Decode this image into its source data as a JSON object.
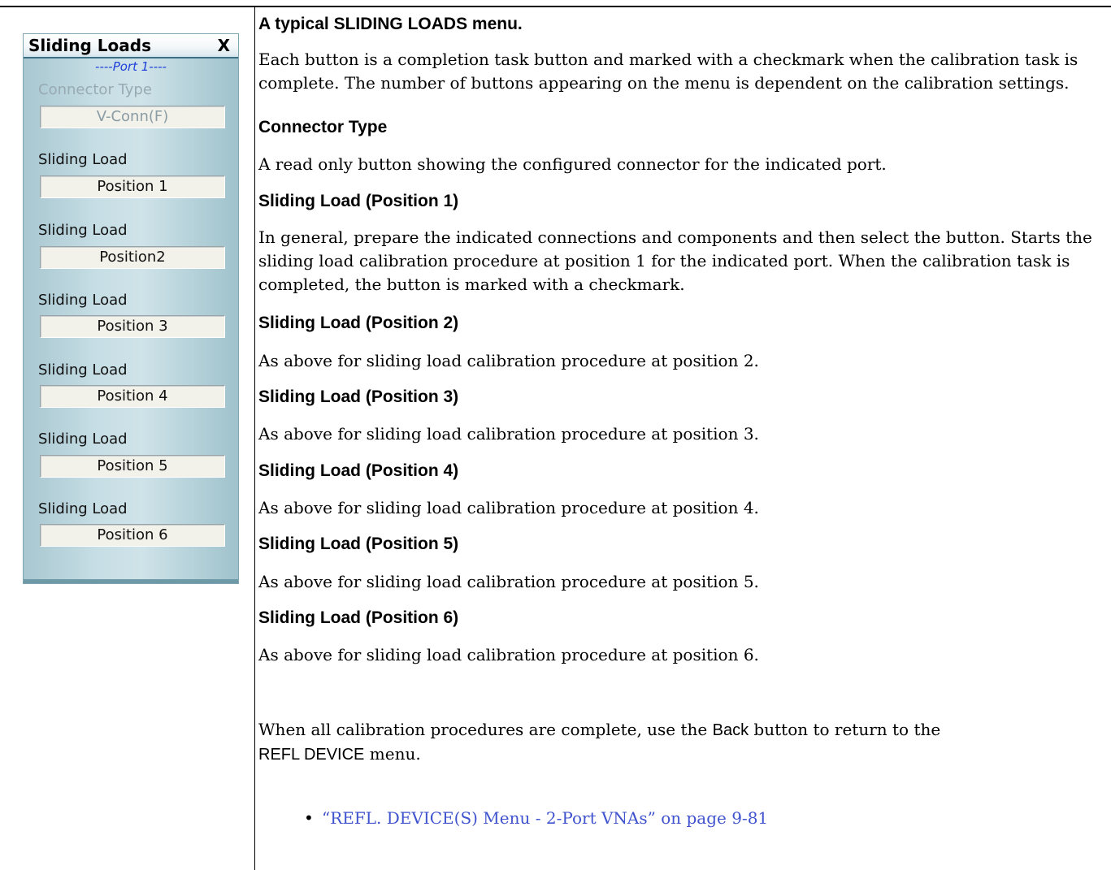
{
  "menu": {
    "title": "Sliding Loads",
    "close": "X",
    "port_label": "----Port 1----",
    "connector": {
      "label": "Connector Type",
      "button": "V-Conn(F)"
    },
    "groups": [
      {
        "label": "Sliding Load",
        "button": "Position 1"
      },
      {
        "label": "Sliding Load",
        "button": "Position2"
      },
      {
        "label": "Sliding Load",
        "button": "Position 3"
      },
      {
        "label": "Sliding Load",
        "button": "Position 4"
      },
      {
        "label": "Sliding Load",
        "button": "Position 5"
      },
      {
        "label": "Sliding Load",
        "button": "Position 6"
      }
    ]
  },
  "doc": {
    "caption": "A typical SLIDING LOADS menu.",
    "intro": "Each button is a completion task button and marked with a checkmark when the calibration task is complete. The number of buttons appearing on the menu is dependent on the calibration settings.",
    "sections": [
      {
        "heading": "Connector Type",
        "text": "A read only button showing the configured connector for the indicated port."
      },
      {
        "heading": "Sliding Load (Position 1)",
        "text": "In general, prepare the indicated connections and components and then select the button. Starts the sliding load calibration procedure at position 1 for the indicated port. When the calibration task is completed, the button is marked with a checkmark."
      },
      {
        "heading": "Sliding Load (Position 2)",
        "text": "As above for sliding load calibration procedure at position 2."
      },
      {
        "heading": "Sliding Load (Position 3)",
        "text": "As above for sliding load calibration procedure at position 3."
      },
      {
        "heading": "Sliding Load (Position 4)",
        "text": "As above for sliding load calibration procedure at position 4."
      },
      {
        "heading": "Sliding Load (Position 5)",
        "text": "As above for sliding load calibration procedure at position 5."
      },
      {
        "heading": "Sliding Load (Position 6)",
        "text": "As above for sliding load calibration procedure at position 6."
      }
    ],
    "closing": {
      "part1": "When all calibration procedures are complete, use the ",
      "back": "Back",
      "part2": " button to return to the",
      "menu_name": "REFL DEVICE",
      "part3": " menu."
    },
    "link": "“REFL. DEVICE(S) Menu - 2-Port VNAs” on page 9-81"
  }
}
